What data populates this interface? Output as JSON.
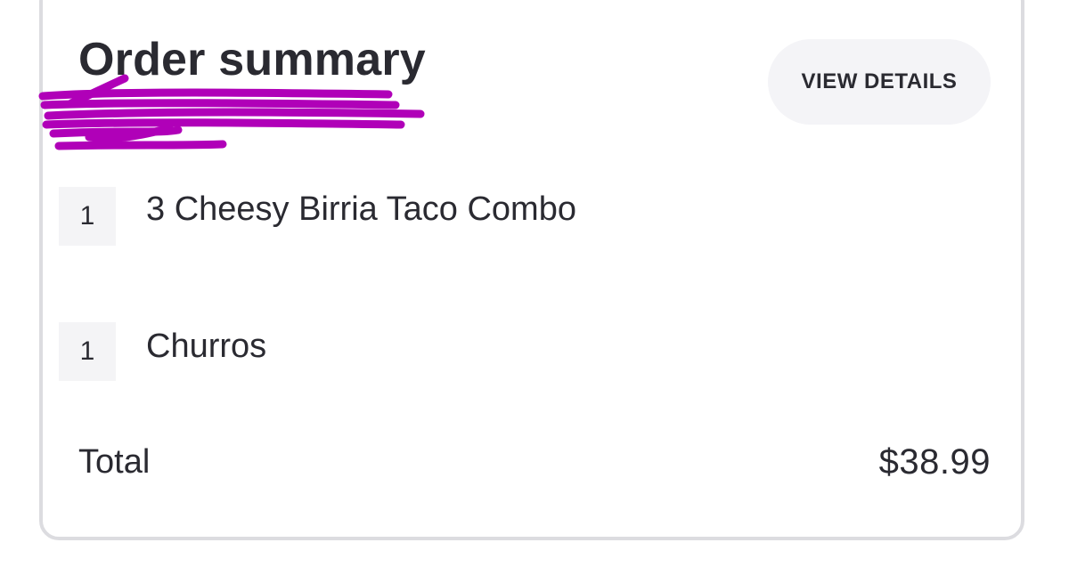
{
  "order_summary": {
    "title": "Order summary",
    "view_details_label": "VIEW DETAILS",
    "items": [
      {
        "quantity": "1",
        "name": "3 Cheesy Birria Taco Combo"
      },
      {
        "quantity": "1",
        "name": "Churros"
      }
    ],
    "total_label": "Total",
    "total_value": "$38.99"
  },
  "colors": {
    "text": "#2a2a31",
    "card_border": "#dcdce0",
    "button_bg": "#f4f4f7",
    "redaction_scribble": "#b000b8"
  }
}
